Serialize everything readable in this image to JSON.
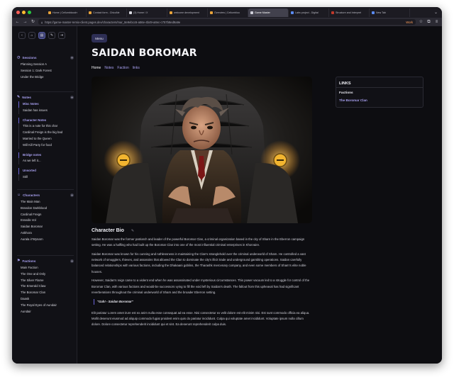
{
  "browser": {
    "tabs": [
      {
        "label": "Home | Cellumbloodrr",
        "color": "#e8a33a",
        "active": false
      },
      {
        "label": "Contact form - ChicoNe",
        "color": "#e8a33a",
        "active": false
      },
      {
        "label": "(3) Home / X",
        "color": "#d9d9e0",
        "active": false
      },
      {
        "label": "welcome development",
        "color": "#e8a33a",
        "active": false
      },
      {
        "label": "Overview | Cellumbloo",
        "color": "#e8a33a",
        "active": false
      },
      {
        "label": "Game Master",
        "color": "#d0d0da",
        "active": true
      },
      {
        "label": "Labs project - Digital",
        "color": "#5a8af0",
        "active": false
      },
      {
        "label": "Structure and Interpret",
        "color": "#c0392b",
        "active": false
      },
      {
        "label": "New Tab",
        "color": "#5a8af0",
        "active": false
      }
    ],
    "url": "https://game-master-remix-client.pages.dev/characters/mar_8e9ebcc6-a56e-4b49-a8ec-c757b8ed9a9e",
    "profile_label": "Work"
  },
  "sidebar": {
    "sessions": {
      "title": "Sessions",
      "items": [
        "Planning Session A",
        "Session 1: Dark Forest",
        "Under the Bridge"
      ]
    },
    "notes": {
      "title": "Notes",
      "groups": [
        {
          "name": "Misc Notes",
          "items": [
            "Saidan has issues"
          ]
        },
        {
          "name": "Character Notes",
          "items": [
            "This is a note for this char",
            "Cardinal Freign is the big bad",
            "Married to the Queen",
            "Will Kill Party for food"
          ]
        },
        {
          "name": "Bridge notes",
          "items": [
            "As we left it..."
          ]
        },
        {
          "name": "Unsorted",
          "items": [
            "Still"
          ]
        }
      ]
    },
    "characters": {
      "title": "Characters",
      "items": [
        "The Main Man",
        "Brandon Darkblood",
        "Cardinal Freign",
        "Erandis Vol",
        "Saidan Boromar",
        "Askhora",
        "Aurala ir'Wynarn"
      ]
    },
    "factions": {
      "title": "Factions",
      "items": [
        "Main Faction",
        "The One and Only",
        "The Silver Flame",
        "The Emerald Claw",
        "The Boromar Clan",
        "Daask",
        "The Royal Eyes of Aundair",
        "Aundair"
      ]
    }
  },
  "main": {
    "menu_label": "Menu",
    "title": "SAIDAN BOROMAR",
    "tabs": [
      "Home",
      "Notes",
      "Faction",
      "links"
    ],
    "active_tab": "Home",
    "bio_heading": "Character Bio",
    "bio_paragraphs": [
      "Saidan Boromar was the former patriarch and leader of the powerful Boromar Clan, a criminal organization based in the city of Sharn in the Eberron campaign setting. He was a halfling who had built up the Boromar Clan into one of the most influential criminal enterprises in Khorvaire.",
      "Saidan Boromar was known for his cunning and ruthlessness in maintaining the Clan's stranglehold over the criminal underworld of Sharn. He controlled a vast network of smugglers, thieves, and assassins that allowed the Clan to dominate the city's illicit trade and underground gambling operations. Saidan carefully balanced relationships with various factions, including the Dhakaani goblins, the Tharashk mercenary company, and even some members of Sharn's elite noble houses.",
      "However, Saidan's reign came to a violent end when he was assassinated under mysterious circumstances. This power vacuum led to a struggle for control of the Boromar Clan, with various factions and would-be successors vying to fill the void left by Saidan's death. The fallout from this upheaval has had significant reverberations throughout the criminal underworld of Sharn and the broader Eberron setting."
    ],
    "quote": "\"Gah! - Saidan Boromar\"",
    "lorem": "Elit pariatur Lorem amet irure est ex anim nulla esse consequat ad ea esse. Nisi consectetur ex velit dolore est elit minim nisi. Est sunt commodo officia ea aliqua. Mollit deserunt eiusmod ad aliquip commodo fugiat proident enim quis do pariatur incididunt. Culpa qui voluptate amet incididunt. Voluptate ipsum nulla cillum dolore. Dolore consectetur reprehenderit incididunt qui et sint. Ea deserunt reprehenderit culpa duis."
  },
  "links_panel": {
    "title": "LINKS",
    "faction_label": "Factions",
    "faction_link": "The Boromar Clan"
  }
}
